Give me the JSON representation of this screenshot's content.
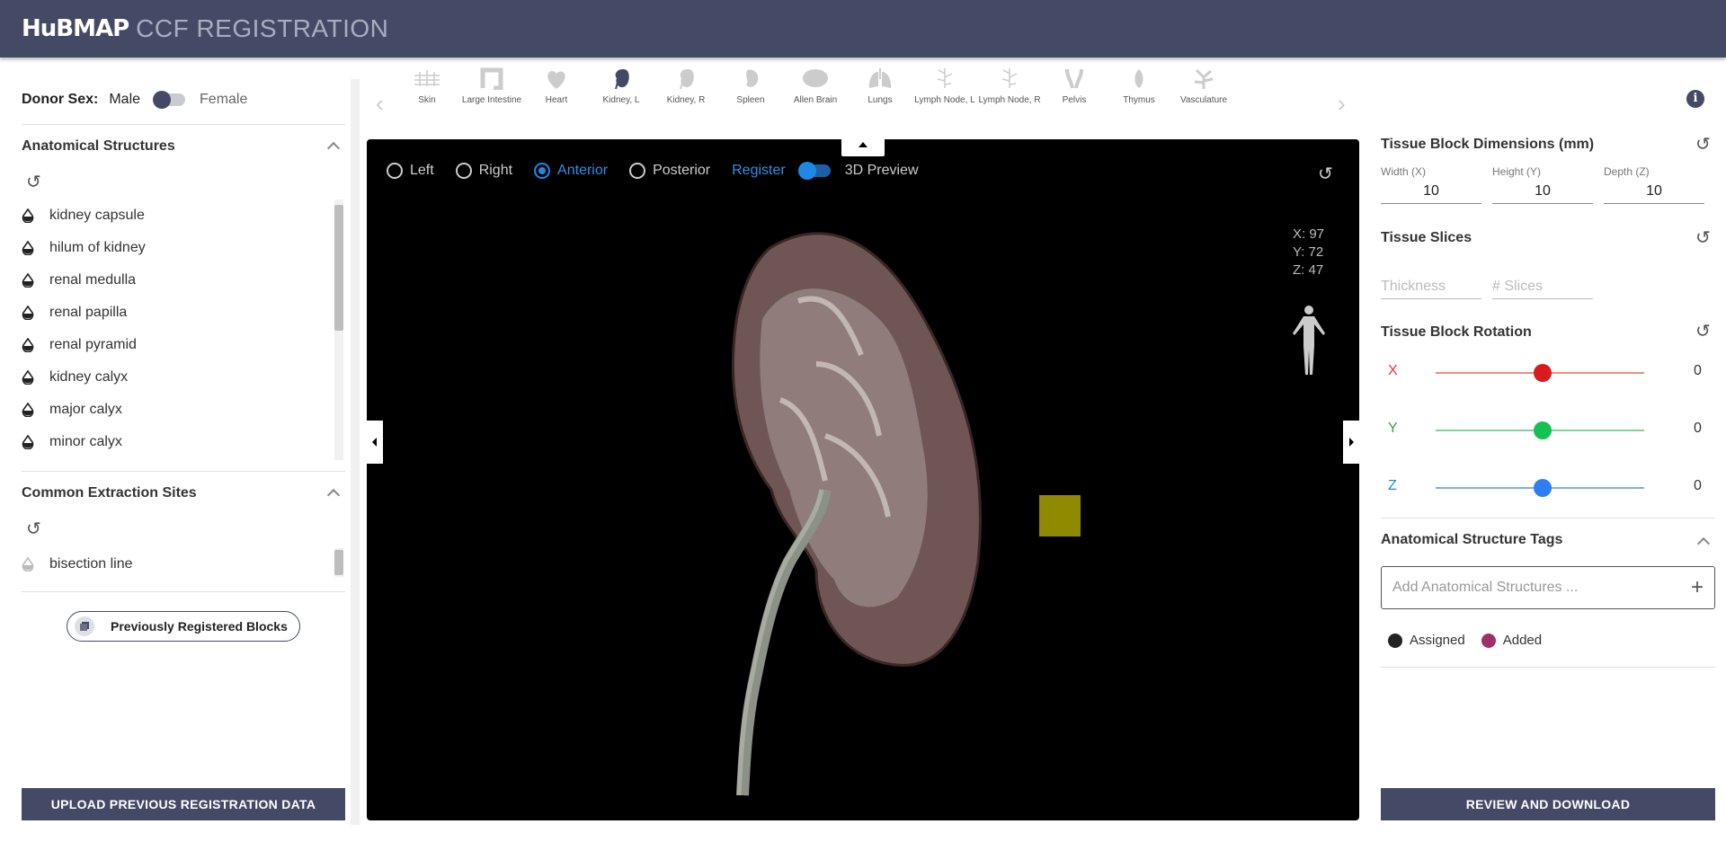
{
  "header": {
    "logo": "HuBMAP",
    "title": "CCF REGISTRATION"
  },
  "left": {
    "donor_label": "Donor Sex:",
    "male": "Male",
    "female": "Female",
    "anatomical_title": "Anatomical Structures",
    "structures": [
      "kidney capsule",
      "hilum of kidney",
      "renal medulla",
      "renal papilla",
      "renal pyramid",
      "kidney calyx",
      "major calyx",
      "minor calyx"
    ],
    "extraction_title": "Common Extraction Sites",
    "extraction_sites": [
      "bisection line"
    ],
    "previous_blocks": "Previously Registered Blocks",
    "upload": "UPLOAD PREVIOUS REGISTRATION DATA"
  },
  "organs": [
    "Skin",
    "Large Intestine",
    "Heart",
    "Kidney, L",
    "Kidney, R",
    "Spleen",
    "Allen Brain",
    "Lungs",
    "Lymph Node, L",
    "Lymph Node, R",
    "Pelvis",
    "Thymus",
    "Vasculature"
  ],
  "viewer": {
    "views": [
      "Left",
      "Right",
      "Anterior",
      "Posterior"
    ],
    "selected_view": "Anterior",
    "register": "Register",
    "preview": "3D Preview",
    "x": "X: 97",
    "y": "Y: 72",
    "z": "Z: 47"
  },
  "right": {
    "dims_title": "Tissue Block Dimensions (mm)",
    "width_label": "Width (X)",
    "height_label": "Height (Y)",
    "depth_label": "Depth (Z)",
    "width": "10",
    "height": "10",
    "depth": "10",
    "slices_title": "Tissue Slices",
    "thickness_ph": "Thickness",
    "slices_ph": "# Slices",
    "rotation_title": "Tissue Block Rotation",
    "rot_x_label": "X",
    "rot_x": "0",
    "rot_y_label": "Y",
    "rot_y": "0",
    "rot_z_label": "Z",
    "rot_z": "0",
    "tags_title": "Anatomical Structure Tags",
    "tags_placeholder": "Add Anatomical Structures ...",
    "assigned": "Assigned",
    "added": "Added",
    "review": "REVIEW AND DOWNLOAD"
  },
  "colors": {
    "header": "#444a65",
    "accent": "#1e88e5",
    "rot_x": "#e53935",
    "rot_y": "#43a047",
    "rot_z": "#1e88e5",
    "added": "#a0306a",
    "assigned": "#222222",
    "tissue_block": "#8f8a00"
  }
}
